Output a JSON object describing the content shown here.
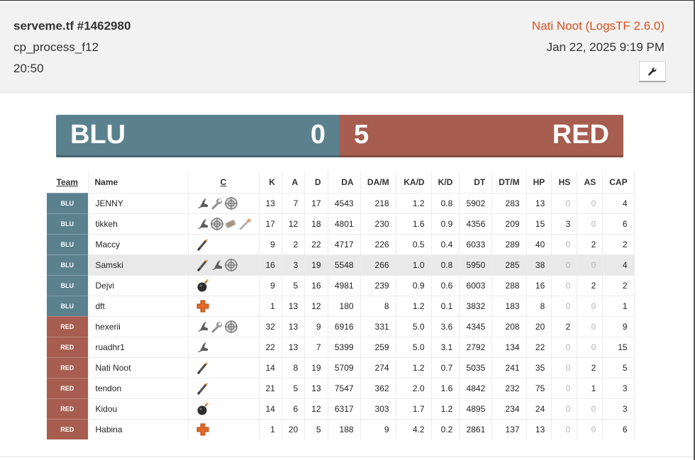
{
  "header": {
    "title": "serveme.tf #1462980",
    "map": "cp_process_f12",
    "duration": "20:50",
    "uploader": "Nati Noot (LogsTF 2.6.0)",
    "date": "Jan 22, 2025 9:19 PM",
    "tool_icon": "wrench-icon"
  },
  "score": {
    "blu_name": "BLU",
    "blu_score": "0",
    "red_score": "5",
    "red_name": "RED",
    "blu_color": "#5b818f",
    "red_color": "#a75d50"
  },
  "table": {
    "columns": [
      "Team",
      "Name",
      "C",
      "K",
      "A",
      "D",
      "DA",
      "DA/M",
      "KA/D",
      "K/D",
      "DT",
      "DT/M",
      "HP",
      "HS",
      "AS",
      "CAP"
    ],
    "rows": [
      {
        "team": "BLU",
        "name": "JENNY",
        "classes": [
          "scout",
          "engineer",
          "sniper"
        ],
        "k": "13",
        "a": "7",
        "d": "17",
        "da": "4543",
        "dam": "218",
        "kad": "1.2",
        "kd": "0.8",
        "dt": "5902",
        "dtm": "283",
        "hp": "13",
        "hs": "0",
        "as": "0",
        "cap": "4"
      },
      {
        "team": "BLU",
        "name": "tikkeh",
        "classes": [
          "scout",
          "sniper",
          "heavy",
          "pyro"
        ],
        "k": "17",
        "a": "12",
        "d": "18",
        "da": "4801",
        "dam": "230",
        "kad": "1.6",
        "kd": "0.9",
        "dt": "4356",
        "dtm": "209",
        "hp": "15",
        "hs": "3",
        "as": "0",
        "cap": "6"
      },
      {
        "team": "BLU",
        "name": "Maccy",
        "classes": [
          "soldier"
        ],
        "k": "9",
        "a": "2",
        "d": "22",
        "da": "4717",
        "dam": "226",
        "kad": "0.5",
        "kd": "0.4",
        "dt": "6033",
        "dtm": "289",
        "hp": "40",
        "hs": "0",
        "as": "2",
        "cap": "2"
      },
      {
        "team": "BLU",
        "name": "Samski",
        "classes": [
          "soldier",
          "scout",
          "sniper"
        ],
        "k": "16",
        "a": "3",
        "d": "19",
        "da": "5548",
        "dam": "266",
        "kad": "1.0",
        "kd": "0.8",
        "dt": "5950",
        "dtm": "285",
        "hp": "38",
        "hs": "0",
        "as": "0",
        "cap": "4"
      },
      {
        "team": "BLU",
        "name": "Dejvi",
        "classes": [
          "demoman"
        ],
        "k": "9",
        "a": "5",
        "d": "16",
        "da": "4981",
        "dam": "239",
        "kad": "0.9",
        "kd": "0.6",
        "dt": "6003",
        "dtm": "288",
        "hp": "16",
        "hs": "0",
        "as": "2",
        "cap": "2"
      },
      {
        "team": "BLU",
        "name": "dft",
        "classes": [
          "medic"
        ],
        "k": "1",
        "a": "13",
        "d": "12",
        "da": "180",
        "dam": "8",
        "kad": "1.2",
        "kd": "0.1",
        "dt": "3832",
        "dtm": "183",
        "hp": "8",
        "hs": "0",
        "as": "0",
        "cap": "1"
      },
      {
        "team": "RED",
        "name": "hexerii",
        "classes": [
          "scout",
          "engineer",
          "sniper"
        ],
        "k": "32",
        "a": "13",
        "d": "9",
        "da": "6916",
        "dam": "331",
        "kad": "5.0",
        "kd": "3.6",
        "dt": "4345",
        "dtm": "208",
        "hp": "20",
        "hs": "2",
        "as": "0",
        "cap": "9"
      },
      {
        "team": "RED",
        "name": "ruadhr1",
        "classes": [
          "scout"
        ],
        "k": "22",
        "a": "13",
        "d": "7",
        "da": "5399",
        "dam": "259",
        "kad": "5.0",
        "kd": "3.1",
        "dt": "2792",
        "dtm": "134",
        "hp": "22",
        "hs": "0",
        "as": "0",
        "cap": "15"
      },
      {
        "team": "RED",
        "name": "Nati Noot",
        "classes": [
          "soldier"
        ],
        "k": "14",
        "a": "8",
        "d": "19",
        "da": "5709",
        "dam": "274",
        "kad": "1.2",
        "kd": "0.7",
        "dt": "5035",
        "dtm": "241",
        "hp": "35",
        "hs": "0",
        "as": "2",
        "cap": "5"
      },
      {
        "team": "RED",
        "name": "tendon",
        "classes": [
          "soldier"
        ],
        "k": "21",
        "a": "5",
        "d": "13",
        "da": "7547",
        "dam": "362",
        "kad": "2.0",
        "kd": "1.6",
        "dt": "4842",
        "dtm": "232",
        "hp": "75",
        "hs": "0",
        "as": "1",
        "cap": "3"
      },
      {
        "team": "RED",
        "name": "Kidou",
        "classes": [
          "demoman"
        ],
        "k": "14",
        "a": "6",
        "d": "12",
        "da": "6317",
        "dam": "303",
        "kad": "1.7",
        "kd": "1.2",
        "dt": "4895",
        "dtm": "234",
        "hp": "24",
        "hs": "0",
        "as": "0",
        "cap": "3"
      },
      {
        "team": "RED",
        "name": "Habina",
        "classes": [
          "medic"
        ],
        "k": "1",
        "a": "20",
        "d": "5",
        "da": "188",
        "dam": "9",
        "kad": "4.2",
        "kd": "0.2",
        "dt": "2861",
        "dtm": "137",
        "hp": "13",
        "hs": "0",
        "as": "0",
        "cap": "6"
      }
    ]
  }
}
